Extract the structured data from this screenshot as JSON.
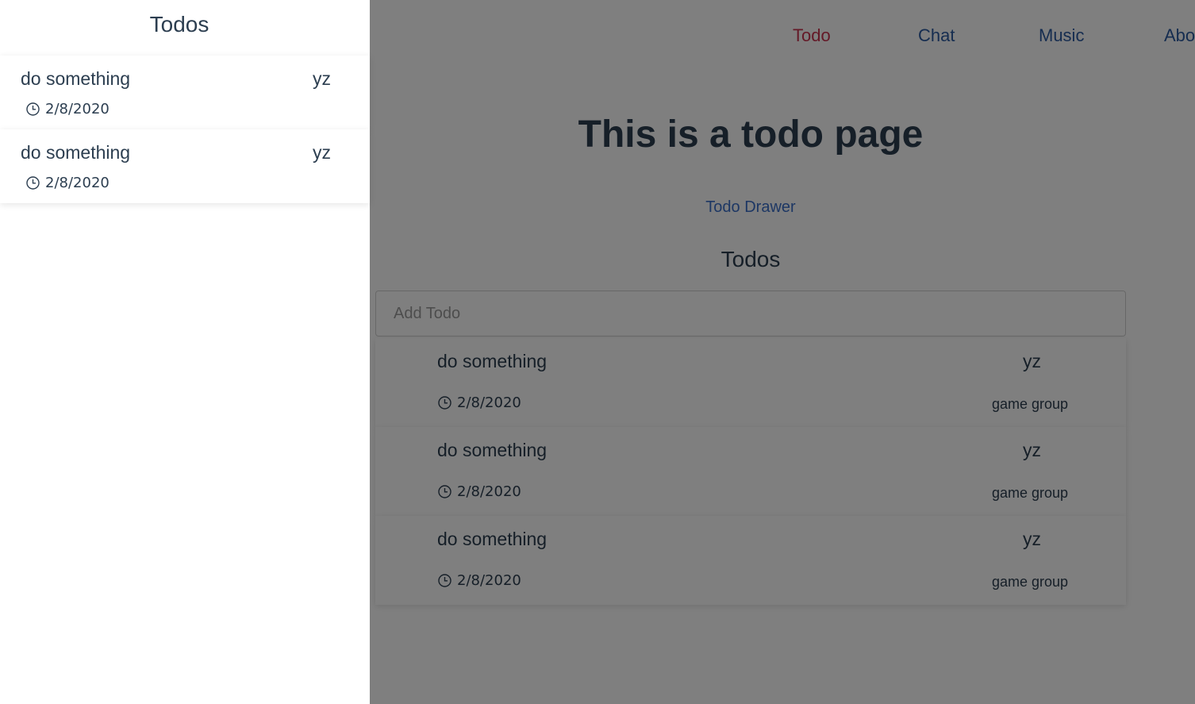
{
  "nav": {
    "items": [
      {
        "label": "Todo",
        "active": true
      },
      {
        "label": "Chat",
        "active": false
      },
      {
        "label": "Music",
        "active": false
      },
      {
        "label": "Abo",
        "active": false
      }
    ]
  },
  "main": {
    "title": "This is a todo page",
    "drawer_link": "Todo Drawer",
    "todos_heading": "Todos",
    "add_placeholder": "Add Todo",
    "todos": [
      {
        "text": "do something",
        "user": "yz",
        "date": "2/8/2020",
        "group": "game group"
      },
      {
        "text": "do something",
        "user": "yz",
        "date": "2/8/2020",
        "group": "game group"
      },
      {
        "text": "do something",
        "user": "yz",
        "date": "2/8/2020",
        "group": "game group"
      }
    ]
  },
  "drawer": {
    "title": "Todos",
    "todos": [
      {
        "text": "do something",
        "user": "yz",
        "date": "2/8/2020"
      },
      {
        "text": "do something",
        "user": "yz",
        "date": "2/8/2020"
      }
    ]
  },
  "colors": {
    "nav_link": "#2c5aa0",
    "nav_active": "#c8324e",
    "text": "#2c3e50",
    "overlay": "rgba(0,0,0,0.5)"
  },
  "icons": {
    "date": "clock-icon"
  }
}
